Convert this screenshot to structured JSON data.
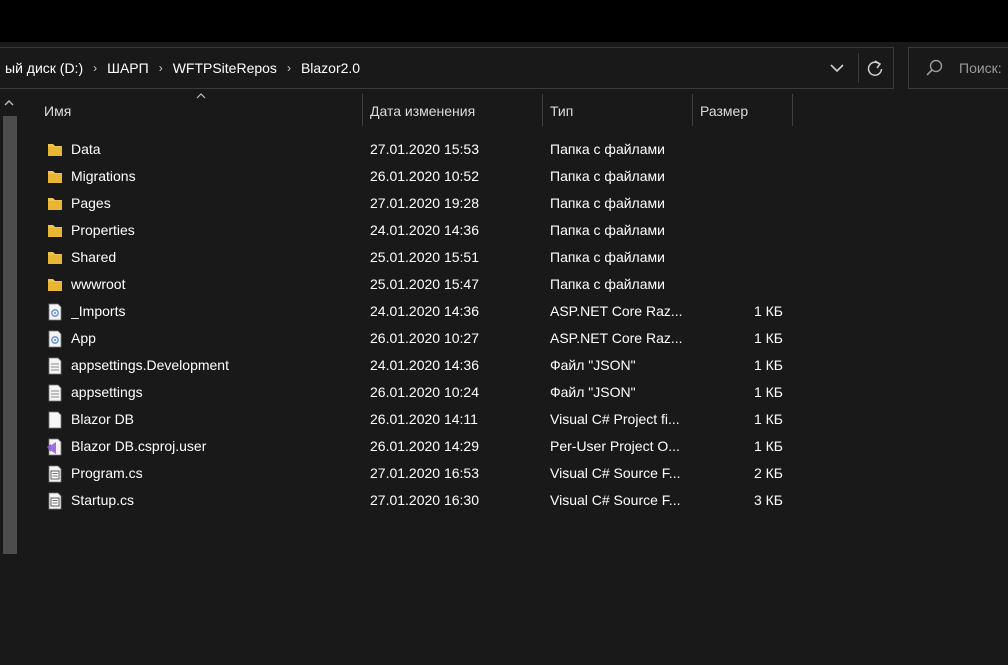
{
  "address": {
    "crumbs": [
      "ый диск (D:)",
      "ШАРП",
      "WFTPSiteRepos",
      "Blazor2.0"
    ],
    "separator": "›"
  },
  "search": {
    "placeholder": "Поиск:"
  },
  "columns": {
    "name": "Имя",
    "date": "Дата изменения",
    "type": "Тип",
    "size": "Размер"
  },
  "files": [
    {
      "name": "Data",
      "date": "27.01.2020 15:53",
      "type": "Папка с файлами",
      "size": "",
      "icon": "folder-icon"
    },
    {
      "name": "Migrations",
      "date": "26.01.2020 10:52",
      "type": "Папка с файлами",
      "size": "",
      "icon": "folder-icon"
    },
    {
      "name": "Pages",
      "date": "27.01.2020 19:28",
      "type": "Папка с файлами",
      "size": "",
      "icon": "folder-icon"
    },
    {
      "name": "Properties",
      "date": "24.01.2020 14:36",
      "type": "Папка с файлами",
      "size": "",
      "icon": "folder-icon"
    },
    {
      "name": "Shared",
      "date": "25.01.2020 15:51",
      "type": "Папка с файлами",
      "size": "",
      "icon": "folder-icon"
    },
    {
      "name": "wwwroot",
      "date": "25.01.2020 15:47",
      "type": "Папка с файлами",
      "size": "",
      "icon": "folder-icon"
    },
    {
      "name": "_Imports",
      "date": "24.01.2020 14:36",
      "type": "ASP.NET Core Raz...",
      "size": "1 КБ",
      "icon": "razor-file-icon"
    },
    {
      "name": "App",
      "date": "26.01.2020 10:27",
      "type": "ASP.NET Core Raz...",
      "size": "1 КБ",
      "icon": "razor-file-icon"
    },
    {
      "name": "appsettings.Development",
      "date": "24.01.2020 14:36",
      "type": "Файл \"JSON\"",
      "size": "1 КБ",
      "icon": "text-file-icon"
    },
    {
      "name": "appsettings",
      "date": "26.01.2020 10:24",
      "type": "Файл \"JSON\"",
      "size": "1 КБ",
      "icon": "text-file-icon"
    },
    {
      "name": "Blazor DB",
      "date": "26.01.2020 14:11",
      "type": "Visual C# Project fi...",
      "size": "1 КБ",
      "icon": "blank-file-icon"
    },
    {
      "name": "Blazor DB.csproj.user",
      "date": "26.01.2020 14:29",
      "type": "Per-User Project O...",
      "size": "1 КБ",
      "icon": "visual-studio-file-icon"
    },
    {
      "name": "Program.cs",
      "date": "27.01.2020 16:53",
      "type": "Visual C# Source F...",
      "size": "2 КБ",
      "icon": "code-file-icon"
    },
    {
      "name": "Startup.cs",
      "date": "27.01.2020 16:30",
      "type": "Visual C# Source F...",
      "size": "3 КБ",
      "icon": "code-file-icon"
    }
  ],
  "colors": {
    "background": "#191919",
    "titlebar": "#000000",
    "folder": "#f0c34a",
    "text": "#ffffff",
    "muted": "#9a9a9a"
  }
}
